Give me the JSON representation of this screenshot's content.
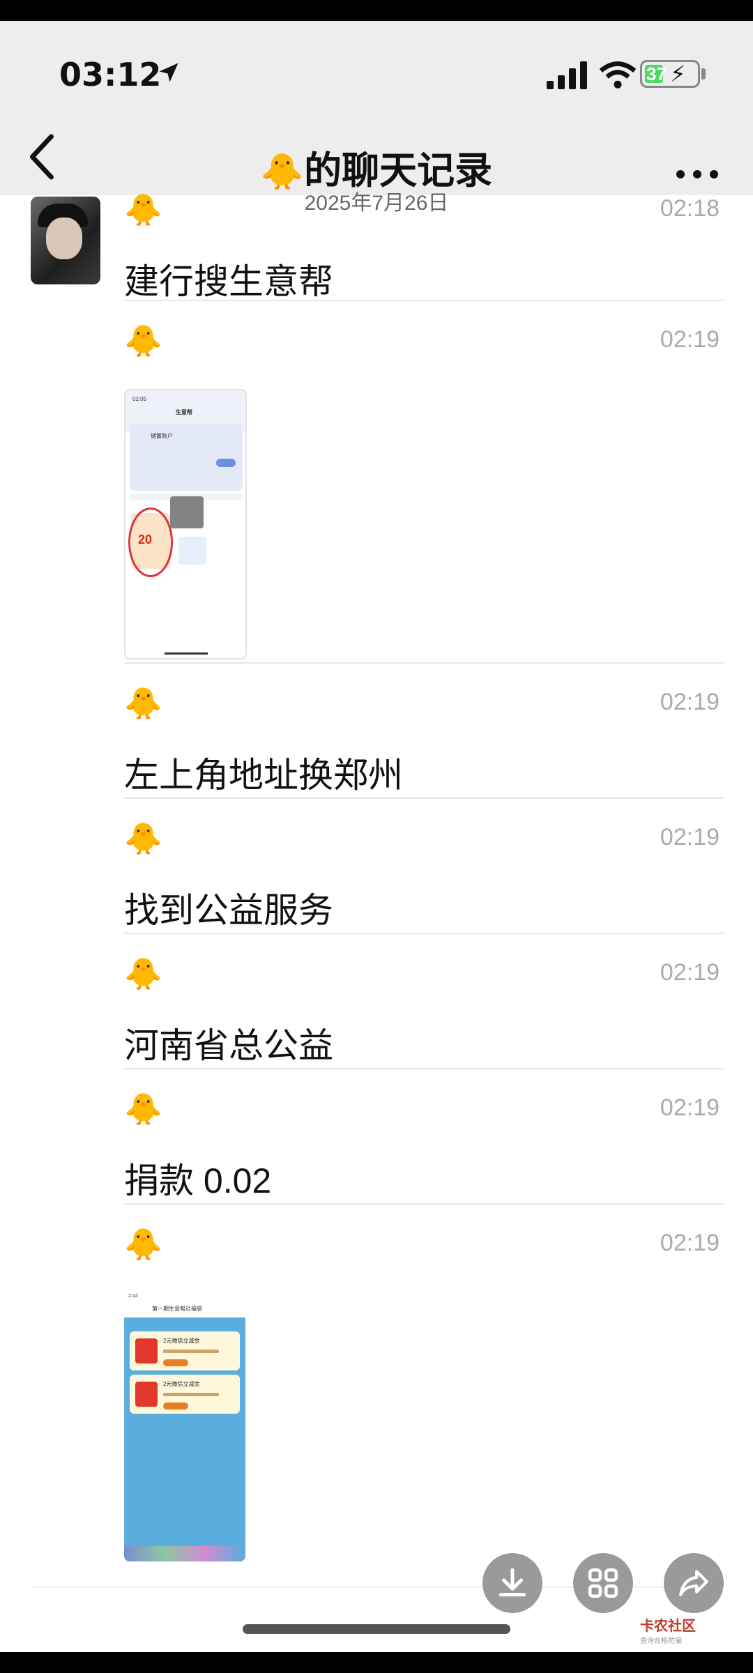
{
  "status_bar": {
    "time": "03:12",
    "battery": "37"
  },
  "header": {
    "title": "的聊天记录",
    "date": "2025年7月26日"
  },
  "messages": [
    {
      "sender": "🐥",
      "time": "02:18",
      "text": "建行搜生意帮"
    },
    {
      "sender": "🐥",
      "time": "02:19",
      "text": ""
    },
    {
      "sender": "🐥",
      "time": "02:19",
      "text": "左上角地址换郑州"
    },
    {
      "sender": "🐥",
      "time": "02:19",
      "text": "找到公益服务"
    },
    {
      "sender": "🐥",
      "time": "02:19",
      "text": "河南省总公益"
    },
    {
      "sender": "🐥",
      "time": "02:19",
      "text": "捐款 0.02"
    },
    {
      "sender": "🐥",
      "time": "02:19",
      "text": ""
    }
  ],
  "thumbnail1": {
    "status_time": "02:05",
    "title": "生意帮",
    "account": "储蓄账户",
    "highlight": "20"
  },
  "thumbnail2": {
    "status_time": "2:14",
    "title": "第一期生意帮近福袋",
    "card1": "2元微信立减金",
    "card2": "2元微信立减金"
  },
  "actions": {
    "download": "download-icon",
    "grid": "grid-icon",
    "share": "share-icon"
  },
  "watermark": {
    "name": "卡农社区",
    "sub": "查询合格防骗"
  }
}
